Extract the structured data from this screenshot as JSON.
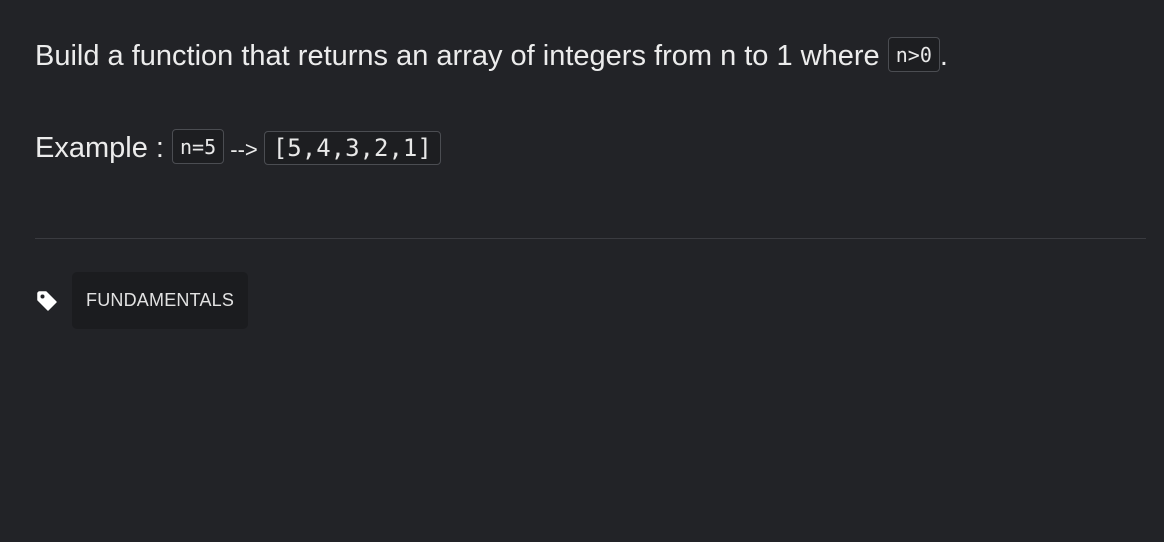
{
  "description": {
    "line1": {
      "text": "Build a function that returns an array of integers from n to 1 where ",
      "code": "n>0",
      "suffix": "."
    },
    "line2": {
      "label": "Example : ",
      "code_input": "n=5",
      "arrow": " --> ",
      "code_output": "[5,4,3,2,1]"
    }
  },
  "tags": {
    "icon": "tag-icon",
    "items": [
      {
        "label": "FUNDAMENTALS"
      }
    ]
  },
  "colors": {
    "background": "#222327",
    "text": "#ececec",
    "code_border": "#4b4d52",
    "tag_chip_bg": "#1b1c1f",
    "divider": "#3a3b40"
  }
}
